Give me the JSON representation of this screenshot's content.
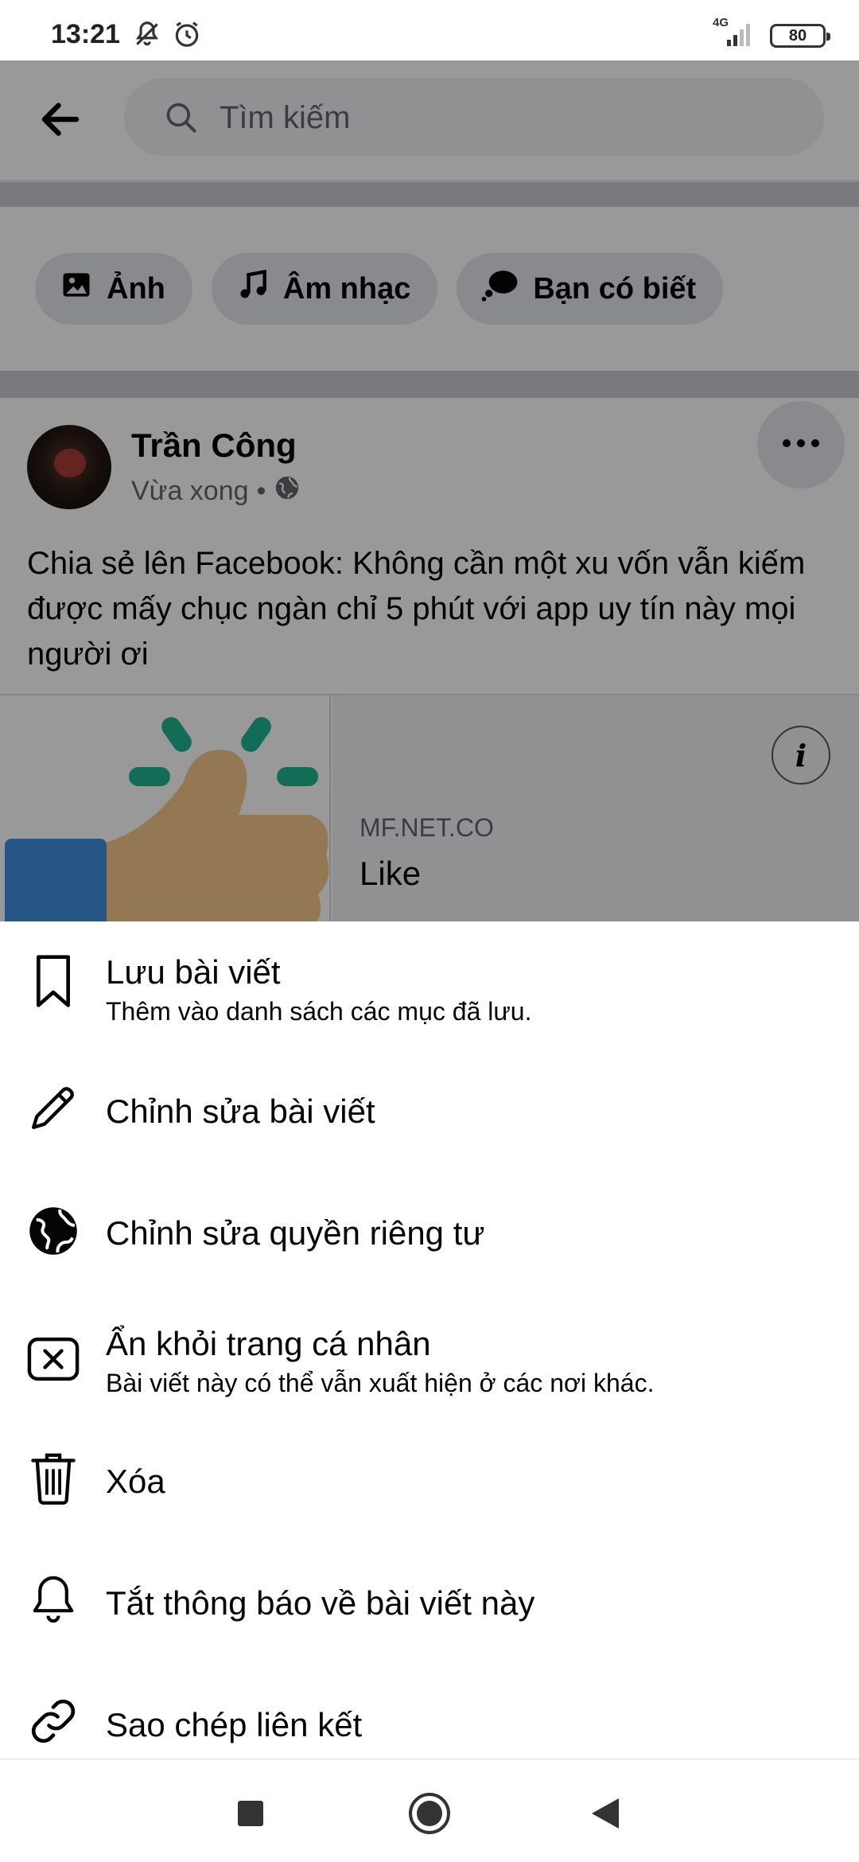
{
  "status_bar": {
    "time": "13:21",
    "network": "4G",
    "battery": "80"
  },
  "search": {
    "placeholder": "Tìm kiếm"
  },
  "chips": [
    {
      "label": "Ảnh",
      "icon": "photo-icon"
    },
    {
      "label": "Âm nhạc",
      "icon": "music-note-icon"
    },
    {
      "label": "Bạn có biết",
      "icon": "thought-bubble-icon"
    }
  ],
  "post": {
    "author": "Trần Công",
    "time": "Vừa xong",
    "separator": "•",
    "text": "Chia sẻ lên Facebook: Không cần một xu vốn vẫn kiếm được mấy chục ngàn chỉ 5 phút với app uy tín này mọi người ơi",
    "link": {
      "domain": "MF.NET.CO",
      "title": "Like",
      "info": "i"
    }
  },
  "menu": {
    "items": [
      {
        "label": "Lưu bài viết",
        "sub": "Thêm vào danh sách các mục đã lưu.",
        "icon": "bookmark-icon"
      },
      {
        "label": "Chỉnh sửa bài viết",
        "icon": "pencil-icon"
      },
      {
        "label": "Chỉnh sửa quyền riêng tư",
        "icon": "globe-icon"
      },
      {
        "label": "Ẩn khỏi trang cá nhân",
        "sub": "Bài viết này có thể vẫn xuất hiện ở các nơi khác.",
        "icon": "hide-x-icon"
      },
      {
        "label": "Xóa",
        "icon": "trash-icon"
      },
      {
        "label": "Tắt thông báo về bài viết này",
        "icon": "bell-icon"
      },
      {
        "label": "Sao chép liên kết",
        "icon": "link-icon"
      }
    ]
  },
  "navbar": {
    "buttons": [
      "recents-icon",
      "home-icon",
      "back-icon"
    ]
  }
}
